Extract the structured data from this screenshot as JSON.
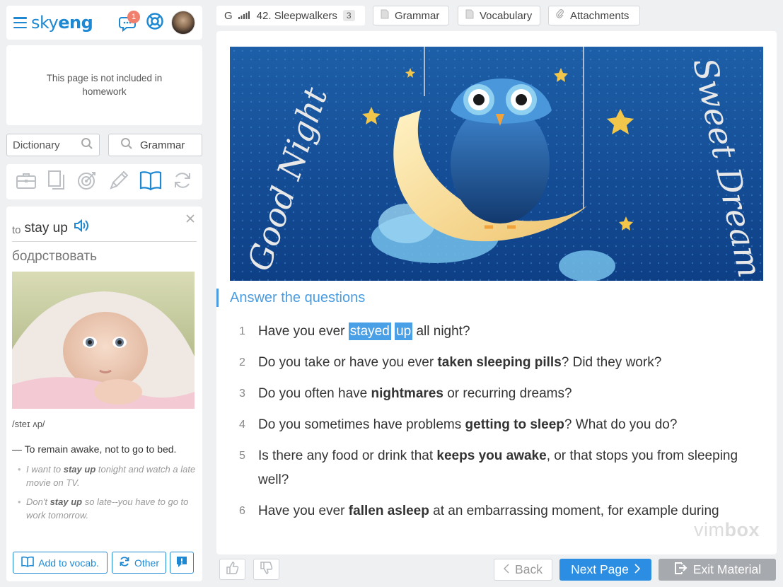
{
  "header": {
    "logo_regular": "sky",
    "logo_bold": "eng",
    "notification_count": "1"
  },
  "homework_notice": "This page is not included in homework",
  "search": {
    "dictionary_label": "Dictionary",
    "grammar_label": "Grammar"
  },
  "tools": [
    "briefcase-icon",
    "pages-icon",
    "target-icon",
    "pencil-icon",
    "book-icon",
    "refresh-icon"
  ],
  "word": {
    "prefix": "to",
    "term": "stay up",
    "translation": "бодрствовать",
    "phonetic": "/steɪ ʌp/",
    "definition": "— To remain awake, not to go to bed.",
    "examples": [
      {
        "before": "I want to ",
        "bold": "stay up",
        "after": " tonight and watch a late movie on TV."
      },
      {
        "before": "Don't ",
        "bold": "stay up",
        "after": " so late--you have to go to work tomorrow."
      }
    ],
    "add_vocab_label": "Add to vocab.",
    "other_label": "Other"
  },
  "tabs": {
    "level_letter": "G",
    "lesson_title": "42. Sleepwalkers",
    "lesson_count": "3",
    "grammar": "Grammar",
    "vocabulary": "Vocabulary",
    "attachments": "Attachments"
  },
  "banner": {
    "left_script": "Good Night",
    "right_script": "Sweet Dream"
  },
  "task_title": "Answer the questions",
  "questions": [
    {
      "num": "1",
      "parts": [
        {
          "t": "Have you ever "
        },
        {
          "t": "stayed",
          "hl": true
        },
        {
          "t": " "
        },
        {
          "t": "up",
          "hl": true
        },
        {
          "t": " all night?"
        }
      ]
    },
    {
      "num": "2",
      "parts": [
        {
          "t": "Do you take or have you ever "
        },
        {
          "t": "taken sleeping pills",
          "b": true
        },
        {
          "t": "? Did they work?"
        }
      ]
    },
    {
      "num": "3",
      "parts": [
        {
          "t": "Do you often have "
        },
        {
          "t": "nightmares",
          "b": true
        },
        {
          "t": " or recurring dreams?"
        }
      ]
    },
    {
      "num": "4",
      "parts": [
        {
          "t": "Do you sometimes have problems "
        },
        {
          "t": "getting to sleep",
          "b": true
        },
        {
          "t": "? What do you do?"
        }
      ]
    },
    {
      "num": "5",
      "parts": [
        {
          "t": "Is there any food or drink that "
        },
        {
          "t": "keeps you awake",
          "b": true
        },
        {
          "t": ", or that stops you from sleeping well?"
        }
      ]
    },
    {
      "num": "6",
      "parts": [
        {
          "t": "Have you ever "
        },
        {
          "t": "fallen asleep",
          "b": true
        },
        {
          "t": " at an embarrassing moment, for example during"
        }
      ]
    }
  ],
  "watermark": {
    "regular": "vim",
    "bold": "box"
  },
  "nav": {
    "back_label": "Back",
    "next_label": "Next Page",
    "exit_label": "Exit Material"
  },
  "colors": {
    "accent": "#1e88d2",
    "next": "#2b8ee2",
    "exit": "#a6a9ad",
    "highlight": "#4aa0e6"
  }
}
